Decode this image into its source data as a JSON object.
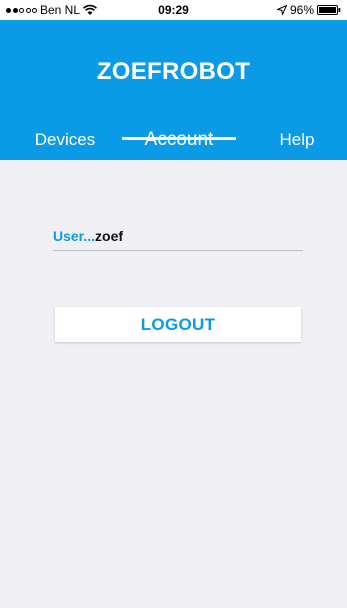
{
  "status_bar": {
    "carrier": "Ben NL",
    "time": "09:29",
    "battery": "96%"
  },
  "header": {
    "title": "ZOEFROBOT"
  },
  "tabs": [
    {
      "label": "Devices",
      "active": false
    },
    {
      "label": "Account",
      "active": true
    },
    {
      "label": "Help",
      "active": false
    }
  ],
  "account": {
    "user_label": "User...",
    "user_value": "zoef",
    "logout_label": "LOGOUT"
  },
  "colors": {
    "accent": "#0b9be6",
    "background": "#efeff4"
  },
  "icons": [
    "signal-dots-icon",
    "wifi-icon",
    "location-arrow-icon",
    "battery-icon"
  ]
}
